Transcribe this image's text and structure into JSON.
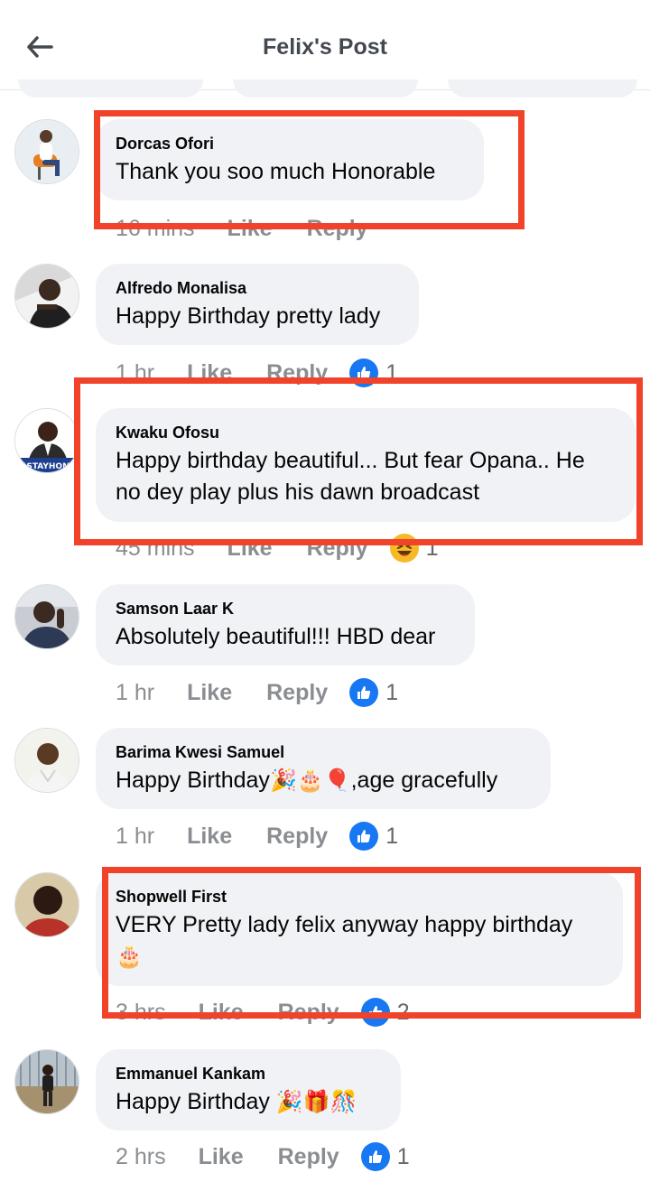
{
  "header": {
    "title": "Felix's Post",
    "back_icon": "arrow-left-icon"
  },
  "comments": [
    {
      "author": "Dorcas Ofori",
      "text": "Thank you soo much Honorable",
      "time": "16 mins",
      "like": "Like",
      "reply": "Reply",
      "reaction": null,
      "count": null,
      "highlighted": true
    },
    {
      "author": "Alfredo Monalisa",
      "text": "Happy Birthday pretty lady",
      "time": "1 hr",
      "like": "Like",
      "reply": "Reply",
      "reaction": "like",
      "count": "1",
      "highlighted": false
    },
    {
      "author": "Kwaku Ofosu",
      "text": "Happy birthday beautiful... But fear Opana.. He no dey play plus his dawn broadcast",
      "time": "45 mins",
      "like": "Like",
      "reply": "Reply",
      "reaction": "haha",
      "count": "1",
      "highlighted": true,
      "avatar_badge": "#STAYHOME"
    },
    {
      "author": "Samson Laar K",
      "text": "Absolutely beautiful!!! HBD dear",
      "time": "1 hr",
      "like": "Like",
      "reply": "Reply",
      "reaction": "like",
      "count": "1",
      "highlighted": false
    },
    {
      "author": "Barima Kwesi Samuel",
      "text_before": "Happy Birthday",
      "text_emoji": "🎉🎂🎈",
      "text_after": ",age gracefully",
      "time": "1 hr",
      "like": "Like",
      "reply": "Reply",
      "reaction": "like",
      "count": "1",
      "highlighted": false
    },
    {
      "author": "Shopwell First",
      "text": "VERY Pretty lady  felix anyway happy birthday",
      "text_emoji": "🎂",
      "time": "3 hrs",
      "like": "Like",
      "reply": "Reply",
      "reaction": "like",
      "count": "2",
      "highlighted": true
    },
    {
      "author": "Emmanuel Kankam",
      "text_before": "Happy Birthday ",
      "text_emoji": "🎉🎁🎊",
      "time": "2 hrs",
      "like": "Like",
      "reply": "Reply",
      "reaction": "like",
      "count": "1",
      "highlighted": false
    }
  ],
  "colors": {
    "highlight": "#f0432a",
    "like_blue": "#1877f2",
    "bubble": "#f0f2f5",
    "meta_gray": "#8a8d91"
  }
}
